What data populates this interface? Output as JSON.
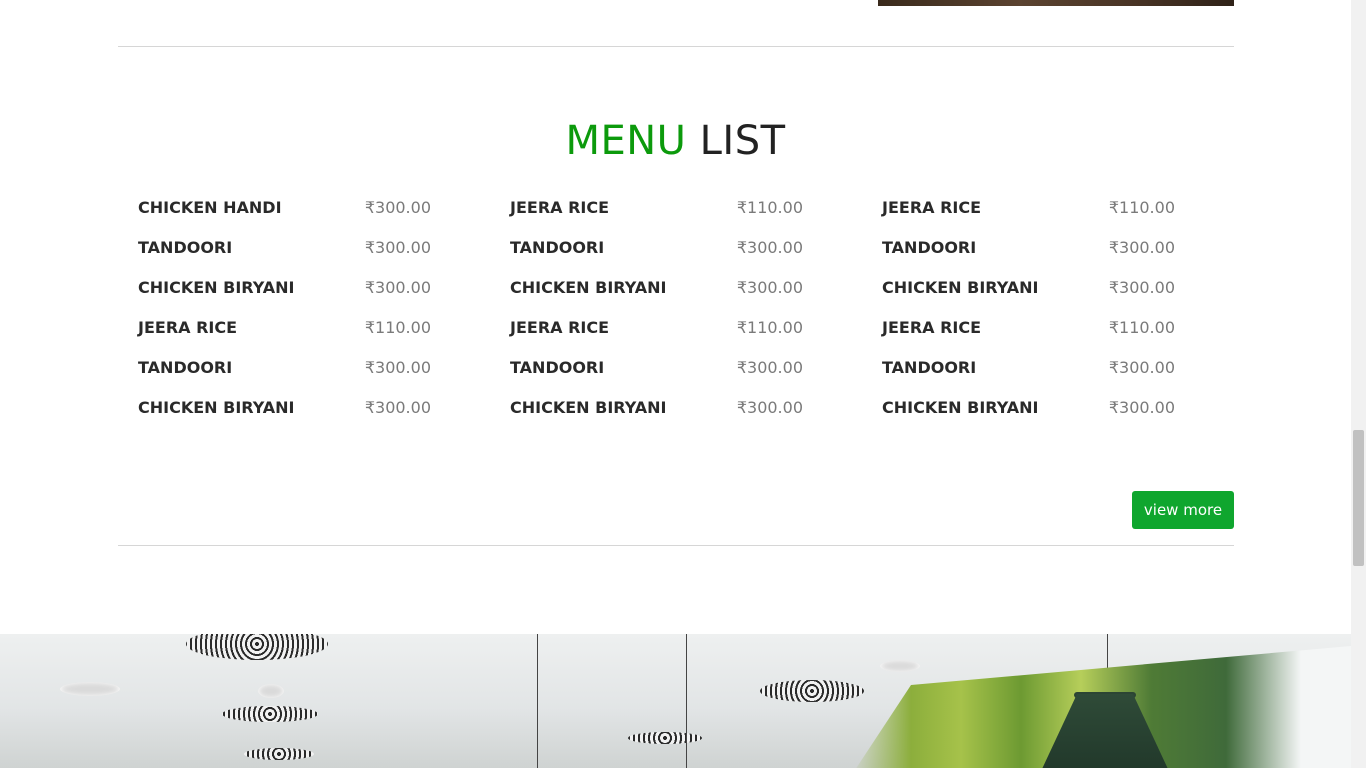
{
  "menu": {
    "title_accent": "MENU",
    "title_rest": "LIST",
    "view_more_label": "view more",
    "columns": [
      [
        {
          "name": "CHICKEN HANDI",
          "price": "₹300.00"
        },
        {
          "name": "TANDOORI",
          "price": "₹300.00"
        },
        {
          "name": "CHICKEN BIRYANI",
          "price": "₹300.00"
        },
        {
          "name": "JEERA RICE",
          "price": "₹110.00"
        },
        {
          "name": "TANDOORI",
          "price": "₹300.00"
        },
        {
          "name": "CHICKEN BIRYANI",
          "price": "₹300.00"
        }
      ],
      [
        {
          "name": "JEERA RICE",
          "price": "₹110.00"
        },
        {
          "name": "TANDOORI",
          "price": "₹300.00"
        },
        {
          "name": "CHICKEN BIRYANI",
          "price": "₹300.00"
        },
        {
          "name": "JEERA RICE",
          "price": "₹110.00"
        },
        {
          "name": "TANDOORI",
          "price": "₹300.00"
        },
        {
          "name": "CHICKEN BIRYANI",
          "price": "₹300.00"
        }
      ],
      [
        {
          "name": "JEERA RICE",
          "price": "₹110.00"
        },
        {
          "name": "TANDOORI",
          "price": "₹300.00"
        },
        {
          "name": "CHICKEN BIRYANI",
          "price": "₹300.00"
        },
        {
          "name": "JEERA RICE",
          "price": "₹110.00"
        },
        {
          "name": "TANDOORI",
          "price": "₹300.00"
        },
        {
          "name": "CHICKEN BIRYANI",
          "price": "₹300.00"
        }
      ]
    ]
  },
  "colors": {
    "accent": "#0c9a0c",
    "button": "#0fa62e",
    "item_name": "#2a2a2a",
    "price": "#7a7a7a",
    "divider": "#d6d6d6"
  }
}
